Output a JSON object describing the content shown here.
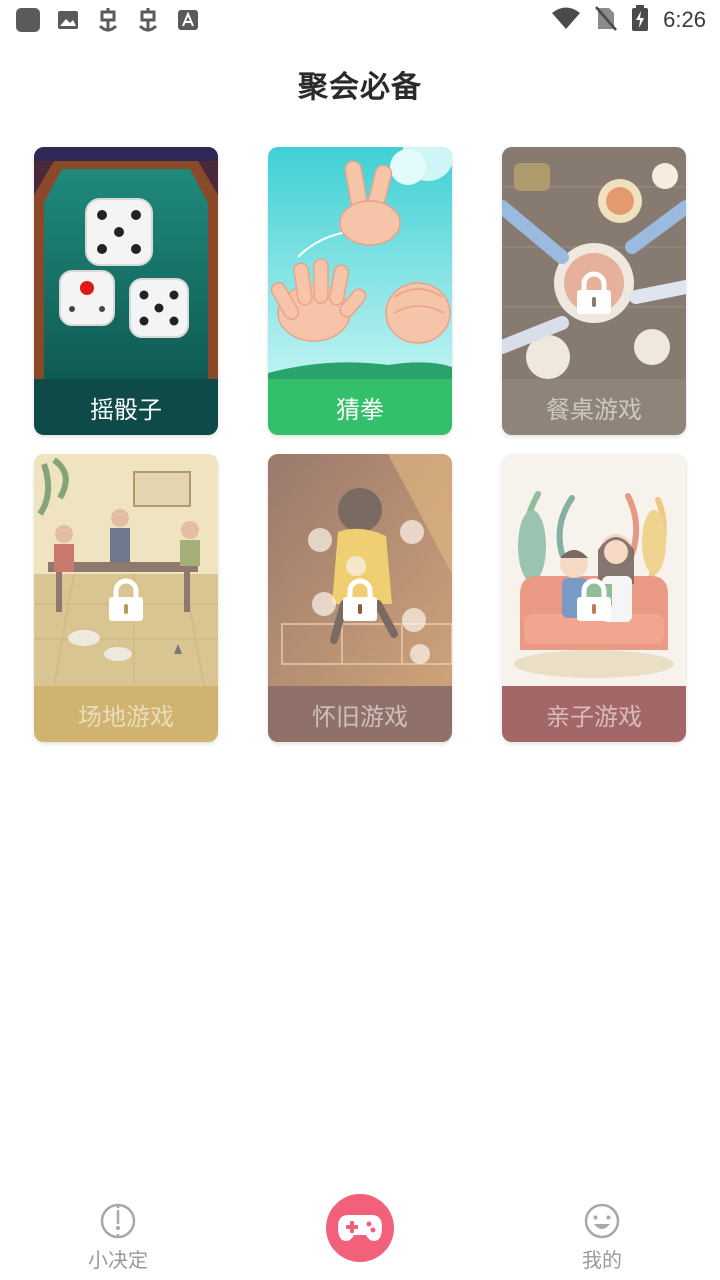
{
  "status_bar": {
    "time": "6:26",
    "left_icons": [
      "app-square-icon",
      "image-icon",
      "bug-icon",
      "bug-icon",
      "font-icon"
    ],
    "right_icons": [
      "wifi-icon",
      "no-sim-icon",
      "battery-charging-icon"
    ]
  },
  "page": {
    "title": "聚会必备"
  },
  "cards": [
    {
      "label": "摇骰子",
      "locked": false,
      "label_color": "#0e4b48",
      "art": "dice"
    },
    {
      "label": "猜拳",
      "locked": false,
      "label_color": "#34c06a",
      "art": "rock-paper-scissors"
    },
    {
      "label": "餐桌游戏",
      "locked": true,
      "label_color": "#5b4a3a",
      "art": "dinner-table"
    },
    {
      "label": "场地游戏",
      "locked": true,
      "label_color": "#b8902c",
      "art": "party-room"
    },
    {
      "label": "怀旧游戏",
      "locked": true,
      "label_color": "#5a2e22",
      "art": "hopscotch"
    },
    {
      "label": "亲子游戏",
      "locked": true,
      "label_color": "#7a2020",
      "art": "parent-child"
    }
  ],
  "bottom_nav": {
    "left": {
      "label": "小决定",
      "icon": "decision-clock-icon"
    },
    "center": {
      "icon": "gamepad-icon",
      "accent": "#f2607a"
    },
    "right": {
      "label": "我的",
      "icon": "smiley-icon"
    }
  }
}
